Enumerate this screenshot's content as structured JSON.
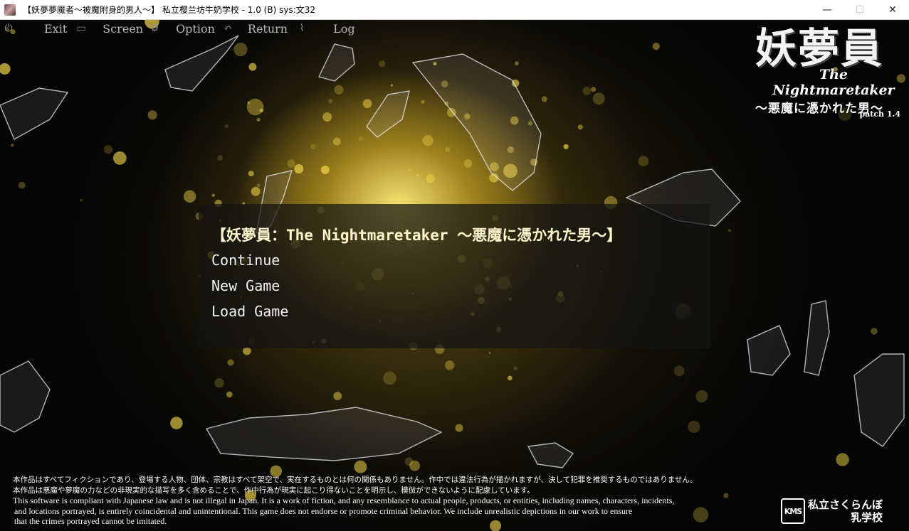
{
  "window": {
    "title": "【妖夢夢魇者～被魔附身的男人～】 私立樱兰坊牛奶学校 - 1.0 (B) sys:文32",
    "controls": {
      "minimize": "—",
      "maximize": "☐",
      "close": "✕"
    }
  },
  "topmenu": {
    "items": [
      {
        "label": "Exit",
        "icon": "power-icon"
      },
      {
        "label": "Screen",
        "icon": "monitor-icon"
      },
      {
        "label": "Option",
        "icon": "gear-icon"
      },
      {
        "label": "Return",
        "icon": "return-arrow-icon"
      },
      {
        "label": "Log",
        "icon": "paperclip-icon"
      }
    ]
  },
  "logo": {
    "kanji": "妖夢員",
    "subtitle": "The Nightmaretaker",
    "japanese": "～悪魔に憑かれた男～",
    "patch": "patch 1.4"
  },
  "menu": {
    "title": "【妖夢員：The Nightmaretaker ～悪魔に憑かれた男～】",
    "items": [
      "Continue",
      "New Game",
      "Load Game"
    ]
  },
  "disclaimer": {
    "jp_line1": "本作品はすべてフィクションであり、登場する人物、団体、宗教はすべて架空で、実在するものとは何の関係もありません。作中では違法行為が描かれますが、決して犯罪を推奨するものではありません。",
    "jp_line2": "本作品は悪魔や夢魔の力などの非現実的な描写を多く含めることで、作中行為が現実に起こり得ないことを明示し、模倣ができないように配慮しています。",
    "en_line1": "This software is compliant with Japanese law and is not illegal in Japan. It is a work of fiction, and any resemblance to actual people, products, or entities, including names, characters, incidents,",
    "en_line2": " and locations portrayed, is entirely coincidental and unintentional. This game does not endorse or promote criminal behavior. We include unrealistic depictions in our work to ensure",
    "en_line3": " that the crimes portrayed cannot be imitated."
  },
  "studio": {
    "mark": "KMS",
    "line1": "私立さくらんぼ",
    "line2": "乳学校"
  },
  "colors": {
    "glow": "#f5d84a",
    "menu_text": "#f2f2f2",
    "menu_title": "#fff6cc",
    "topmenu_text": "#b9b9b9"
  }
}
